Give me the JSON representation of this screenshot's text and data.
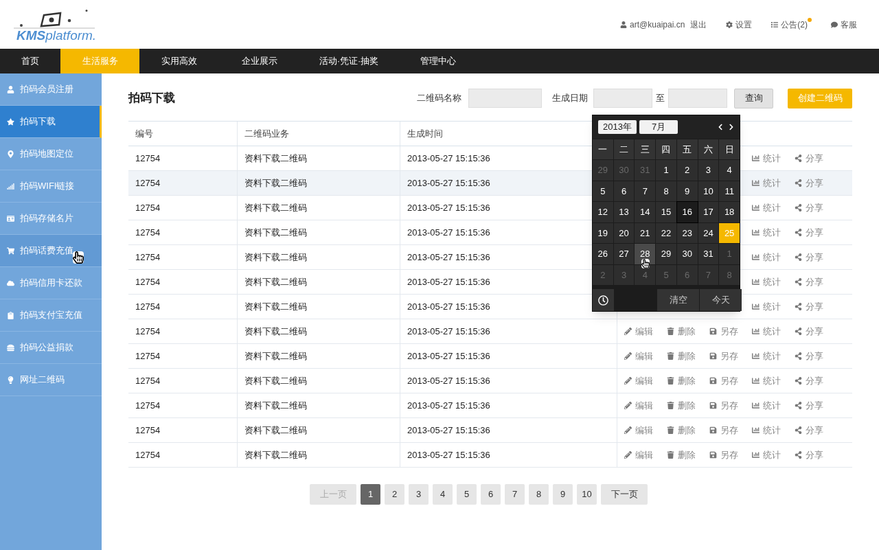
{
  "logo": {
    "bold": "KMS",
    "rest": "platform."
  },
  "top_links": [
    {
      "kind": "user",
      "label": "art@kuaipai.cn"
    },
    {
      "kind": "text",
      "label": "退出"
    },
    {
      "kind": "settings",
      "label": "设置"
    },
    {
      "kind": "notice",
      "label": "公告(2)",
      "unread": true
    },
    {
      "kind": "chat",
      "label": "客服"
    }
  ],
  "nav": [
    {
      "label": "首页",
      "selected": false
    },
    {
      "label": "生活服务",
      "selected": true
    },
    {
      "label": "实用高效",
      "selected": false
    },
    {
      "label": "企业展示",
      "selected": false
    },
    {
      "label": "活动·凭证·抽奖",
      "selected": false
    },
    {
      "label": "管理中心",
      "selected": false
    }
  ],
  "sidebar": [
    {
      "label": "拍码会员注册",
      "selected": false,
      "hovered": false
    },
    {
      "label": "拍码下载",
      "selected": true,
      "hovered": false
    },
    {
      "label": "拍码地图定位",
      "selected": false,
      "hovered": false
    },
    {
      "label": "拍码WIFI链接",
      "selected": false,
      "hovered": false
    },
    {
      "label": "拍码存储名片",
      "selected": false,
      "hovered": false
    },
    {
      "label": "拍码话费充值",
      "selected": false,
      "hovered": true
    },
    {
      "label": "拍码信用卡还款",
      "selected": false,
      "hovered": false
    },
    {
      "label": "拍码支付宝充值",
      "selected": false,
      "hovered": false
    },
    {
      "label": "拍码公益捐款",
      "selected": false,
      "hovered": false
    },
    {
      "label": "网址二维码",
      "selected": false,
      "hovered": false
    }
  ],
  "page_title": "拍码下载",
  "filters": {
    "name_label": "二维码名称",
    "date_label": "生成日期",
    "to_label": "至",
    "query_button": "查询",
    "create_button": "创建二维码"
  },
  "table": {
    "columns": [
      "编号",
      "二维码业务",
      "生成时间"
    ],
    "rows": [
      {
        "cells": [
          "12754",
          "资料下载二维码",
          "2013-05-27 15:15:36"
        ],
        "selected": false,
        "actions": [
          {
            "kind": "stats",
            "label": "统计"
          },
          {
            "kind": "share",
            "label": "分享"
          }
        ]
      },
      {
        "cells": [
          "12754",
          "资料下载二维码",
          "2013-05-27 15:15:36"
        ],
        "selected": true,
        "actions": [
          {
            "kind": "stats",
            "label": "统计"
          },
          {
            "kind": "share",
            "label": "分享"
          }
        ]
      },
      {
        "cells": [
          "12754",
          "资料下载二维码",
          "2013-05-27 15:15:36"
        ],
        "selected": false,
        "actions": [
          {
            "kind": "stats",
            "label": "统计"
          },
          {
            "kind": "share",
            "label": "分享"
          }
        ]
      },
      {
        "cells": [
          "12754",
          "资料下载二维码",
          "2013-05-27 15:15:36"
        ],
        "selected": false,
        "actions": [
          {
            "kind": "stats",
            "label": "统计"
          },
          {
            "kind": "share",
            "label": "分享"
          }
        ]
      },
      {
        "cells": [
          "12754",
          "资料下载二维码",
          "2013-05-27 15:15:36"
        ],
        "selected": false,
        "actions": [
          {
            "kind": "stats",
            "label": "统计"
          },
          {
            "kind": "share",
            "label": "分享"
          }
        ]
      },
      {
        "cells": [
          "12754",
          "资料下载二维码",
          "2013-05-27 15:15:36"
        ],
        "selected": false,
        "actions": [
          {
            "kind": "stats",
            "label": "统计"
          },
          {
            "kind": "share",
            "label": "分享"
          }
        ]
      },
      {
        "cells": [
          "12754",
          "资料下载二维码",
          "2013-05-27 15:15:36"
        ],
        "selected": false,
        "actions": [
          {
            "kind": "stats",
            "label": "统计"
          },
          {
            "kind": "share",
            "label": "分享"
          }
        ]
      },
      {
        "cells": [
          "12754",
          "资料下载二维码",
          "2013-05-27 15:15:36"
        ],
        "selected": false,
        "actions": [
          {
            "kind": "edit",
            "label": "编辑"
          },
          {
            "kind": "delete",
            "label": "删除"
          },
          {
            "kind": "save",
            "label": "另存"
          },
          {
            "kind": "stats",
            "label": "统计"
          },
          {
            "kind": "share",
            "label": "分享"
          }
        ]
      },
      {
        "cells": [
          "12754",
          "资料下载二维码",
          "2013-05-27 15:15:36"
        ],
        "selected": false,
        "actions": [
          {
            "kind": "edit",
            "label": "编辑"
          },
          {
            "kind": "delete",
            "label": "删除"
          },
          {
            "kind": "save",
            "label": "另存"
          },
          {
            "kind": "stats",
            "label": "统计"
          },
          {
            "kind": "share",
            "label": "分享"
          }
        ]
      },
      {
        "cells": [
          "12754",
          "资料下载二维码",
          "2013-05-27 15:15:36"
        ],
        "selected": false,
        "actions": [
          {
            "kind": "edit",
            "label": "编辑"
          },
          {
            "kind": "delete",
            "label": "删除"
          },
          {
            "kind": "save",
            "label": "另存"
          },
          {
            "kind": "stats",
            "label": "统计"
          },
          {
            "kind": "share",
            "label": "分享"
          }
        ]
      },
      {
        "cells": [
          "12754",
          "资料下载二维码",
          "2013-05-27 15:15:36"
        ],
        "selected": false,
        "actions": [
          {
            "kind": "edit",
            "label": "编辑"
          },
          {
            "kind": "delete",
            "label": "删除"
          },
          {
            "kind": "save",
            "label": "另存"
          },
          {
            "kind": "stats",
            "label": "统计"
          },
          {
            "kind": "share",
            "label": "分享"
          }
        ]
      },
      {
        "cells": [
          "12754",
          "资料下载二维码",
          "2013-05-27 15:15:36"
        ],
        "selected": false,
        "actions": [
          {
            "kind": "edit",
            "label": "编辑"
          },
          {
            "kind": "delete",
            "label": "删除"
          },
          {
            "kind": "save",
            "label": "另存"
          },
          {
            "kind": "stats",
            "label": "统计"
          },
          {
            "kind": "share",
            "label": "分享"
          }
        ]
      },
      {
        "cells": [
          "12754",
          "资料下载二维码",
          "2013-05-27 15:15:36"
        ],
        "selected": false,
        "actions": [
          {
            "kind": "edit",
            "label": "编辑"
          },
          {
            "kind": "delete",
            "label": "删除"
          },
          {
            "kind": "save",
            "label": "另存"
          },
          {
            "kind": "stats",
            "label": "统计"
          },
          {
            "kind": "share",
            "label": "分享"
          }
        ]
      }
    ]
  },
  "calendar": {
    "year": "2013年",
    "month": "7月",
    "weekdays": [
      "一",
      "二",
      "三",
      "四",
      "五",
      "六",
      "日"
    ],
    "days": [
      {
        "text": "29",
        "kind": "outside"
      },
      {
        "text": "30",
        "kind": "outside"
      },
      {
        "text": "31",
        "kind": "outside"
      },
      {
        "text": "1",
        "kind": "normal"
      },
      {
        "text": "2",
        "kind": "normal"
      },
      {
        "text": "3",
        "kind": "normal"
      },
      {
        "text": "4",
        "kind": "normal"
      },
      {
        "text": "5",
        "kind": "normal"
      },
      {
        "text": "6",
        "kind": "normal"
      },
      {
        "text": "7",
        "kind": "normal"
      },
      {
        "text": "8",
        "kind": "normal"
      },
      {
        "text": "9",
        "kind": "normal"
      },
      {
        "text": "10",
        "kind": "normal"
      },
      {
        "text": "11",
        "kind": "normal"
      },
      {
        "text": "12",
        "kind": "normal"
      },
      {
        "text": "13",
        "kind": "normal"
      },
      {
        "text": "14",
        "kind": "normal"
      },
      {
        "text": "15",
        "kind": "normal"
      },
      {
        "text": "16",
        "kind": "today"
      },
      {
        "text": "17",
        "kind": "normal"
      },
      {
        "text": "18",
        "kind": "normal"
      },
      {
        "text": "19",
        "kind": "normal"
      },
      {
        "text": "20",
        "kind": "normal"
      },
      {
        "text": "21",
        "kind": "normal"
      },
      {
        "text": "22",
        "kind": "normal"
      },
      {
        "text": "23",
        "kind": "normal"
      },
      {
        "text": "24",
        "kind": "normal"
      },
      {
        "text": "25",
        "kind": "selected"
      },
      {
        "text": "26",
        "kind": "normal"
      },
      {
        "text": "27",
        "kind": "normal"
      },
      {
        "text": "28",
        "kind": "hover"
      },
      {
        "text": "29",
        "kind": "normal"
      },
      {
        "text": "30",
        "kind": "normal"
      },
      {
        "text": "31",
        "kind": "normal"
      },
      {
        "text": "1",
        "kind": "outside"
      },
      {
        "text": "2",
        "kind": "outside"
      },
      {
        "text": "3",
        "kind": "outside"
      },
      {
        "text": "4",
        "kind": "outside"
      },
      {
        "text": "5",
        "kind": "outside"
      },
      {
        "text": "6",
        "kind": "outside"
      },
      {
        "text": "7",
        "kind": "outside"
      },
      {
        "text": "8",
        "kind": "outside"
      }
    ],
    "clear_button": "清空",
    "today_button": "今天"
  },
  "pagination": {
    "prev": {
      "label": "上一页",
      "disabled": true
    },
    "pages": [
      {
        "label": "1",
        "selected": true
      },
      {
        "label": "2",
        "selected": false
      },
      {
        "label": "3",
        "selected": false
      },
      {
        "label": "4",
        "selected": false
      },
      {
        "label": "5",
        "selected": false
      },
      {
        "label": "6",
        "selected": false
      },
      {
        "label": "7",
        "selected": false
      },
      {
        "label": "8",
        "selected": false
      },
      {
        "label": "9",
        "selected": false
      },
      {
        "label": "10",
        "selected": false
      }
    ],
    "next": {
      "label": "下一页",
      "disabled": false
    }
  }
}
